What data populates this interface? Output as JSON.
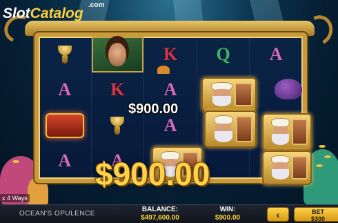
{
  "watermark": {
    "part1": "Slot",
    "part2": "Catalog",
    "suffix": ".com"
  },
  "reels": [
    [
      "cup",
      "A",
      "chest",
      "A"
    ],
    [
      "portrait",
      "K",
      "cup",
      "A"
    ],
    [
      "K",
      "A",
      "A",
      "wild"
    ],
    [
      "Q",
      "wild",
      "wild",
      "wild"
    ],
    [
      "A",
      "octopus",
      "wild",
      "wild"
    ]
  ],
  "wins": {
    "line_win": "$900.00",
    "total_win_display": "$900.00"
  },
  "ways_label": "x 4 Ways",
  "bottom_bar": {
    "game_name": "OCEAN'S OPULENCE",
    "balance_label": "BALANCE:",
    "balance_value": "$497,600.00",
    "win_label": "WIN:",
    "win_value": "$900.00",
    "prev_bet_glyph": "‹",
    "bet_label": "BET",
    "bet_value": "$300"
  },
  "colors": {
    "gold": "#ffd23a",
    "frame": "#c89a3a",
    "letter_A": "#d06cc2",
    "letter_K": "#d5344a",
    "letter_Q": "#40b070"
  }
}
